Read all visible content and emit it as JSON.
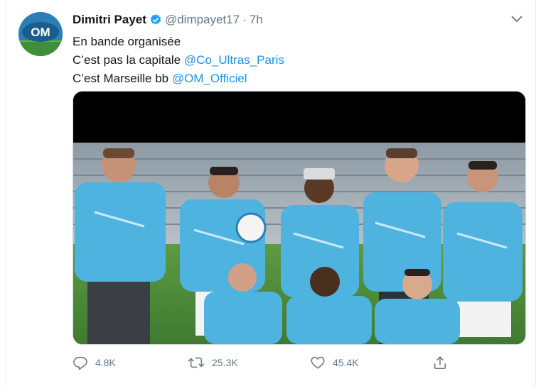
{
  "tweet": {
    "author_name": "Dimitri Payet",
    "handle": "@dimpayet17",
    "separator": "·",
    "time": "7h",
    "lines": [
      {
        "text": "En bande organisée",
        "mention": ""
      },
      {
        "text": "C’est pas la capitale ",
        "mention": "@Co_Ultras_Paris"
      },
      {
        "text": "C’est Marseille bb ",
        "mention": "@OM_Officiel"
      }
    ],
    "avatar_label": "OM"
  },
  "actions": {
    "reply_count": "4.8K",
    "retweet_count": "25.3K",
    "like_count": "45.4K"
  },
  "colors": {
    "link": "#1b95e0",
    "verified": "#1da1f2",
    "muted": "#657786",
    "jersey": "#4fb3df",
    "pitch": "#4e8a3a"
  },
  "icons": [
    "verified-badge-icon",
    "chevron-down-icon",
    "reply-icon",
    "retweet-icon",
    "like-icon",
    "share-icon"
  ]
}
